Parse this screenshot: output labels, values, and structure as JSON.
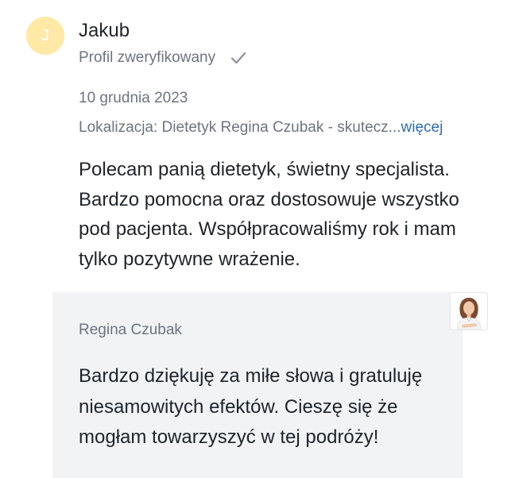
{
  "review": {
    "avatar_initial": "J",
    "author": "Jakub",
    "verified_label": "Profil zweryfikowany",
    "date": "10 grudnia 2023",
    "location_text": "Lokalizacja: Dietetyk Regina Czubak - skutecz...",
    "more_link": "więcej",
    "body": "Polecam panią dietetyk, świetny specjalista. Bardzo pomocna oraz dostosowuje wszystko pod pacjenta. Współpracowaliśmy rok i mam tylko pozytywne wrażenie."
  },
  "reply": {
    "author": "Regina Czubak",
    "body": "Bardzo dziękuję za miłe słowa i gratuluję niesamowitych efektów. Cieszę się że mogłam towarzyszyć w tej podróży!"
  },
  "colors": {
    "avatar_bg": "#ffe9a6",
    "muted_text": "#6c7480",
    "link": "#2a6fb5",
    "reply_bg": "#f1f3f5"
  },
  "icons": {
    "verified": "check-icon",
    "reply_avatar": "doctor-photo"
  }
}
